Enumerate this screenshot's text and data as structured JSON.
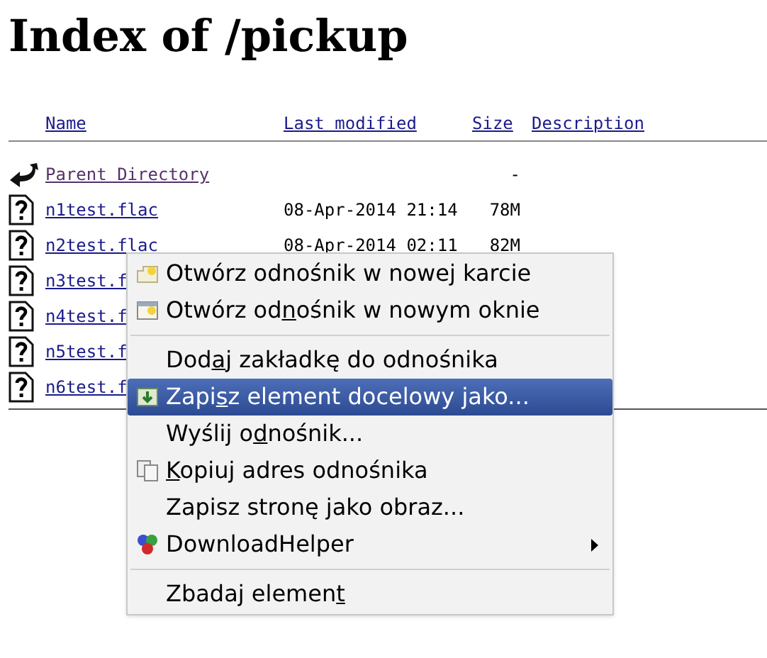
{
  "title": "Index of /pickup",
  "columns": [
    "Name",
    "Last modified",
    "Size",
    "Description"
  ],
  "rows": [
    {
      "kind": "parent",
      "name": "Parent Directory",
      "size": "-"
    },
    {
      "kind": "file",
      "name": "n1test.flac",
      "modified": "08-Apr-2014 21:14",
      "size": "78M"
    },
    {
      "kind": "file",
      "name": "n2test.flac",
      "modified": "08-Apr-2014 02:11",
      "size": "82M"
    },
    {
      "kind": "file",
      "name": "n3test.f"
    },
    {
      "kind": "file",
      "name": "n4test.f"
    },
    {
      "kind": "file",
      "name": "n5test.f"
    },
    {
      "kind": "file",
      "name": "n6test.f"
    }
  ],
  "context_menu": {
    "items": [
      {
        "kind": "item",
        "before": "Otwórz odnośnik w nowej karcie",
        "selected": false,
        "submenu": false
      },
      {
        "kind": "item",
        "before": "Otwórz od",
        "key": "n",
        "after": "ośnik w nowym oknie",
        "selected": false,
        "submenu": false
      },
      {
        "kind": "separator"
      },
      {
        "kind": "item",
        "before": "Dod",
        "key": "a",
        "after": "j zakładkę do odnośnika",
        "selected": false,
        "submenu": false
      },
      {
        "kind": "item",
        "before": "Zapi",
        "key": "s",
        "after": "z element docelowy jako...",
        "selected": true,
        "submenu": false
      },
      {
        "kind": "item",
        "before": "Wyślij o",
        "key": "d",
        "after": "nośnik...",
        "selected": false,
        "submenu": false
      },
      {
        "kind": "item",
        "key": "K",
        "after": "opiuj adres odnośnika",
        "selected": false,
        "submenu": false
      },
      {
        "kind": "item",
        "before": "Zapisz stronę jako obraz...",
        "selected": false,
        "submenu": false
      },
      {
        "kind": "item",
        "before": "DownloadHelper",
        "selected": false,
        "submenu": true
      },
      {
        "kind": "separator"
      },
      {
        "kind": "item",
        "before": "Zbadaj elemen",
        "key": "t",
        "selected": false,
        "submenu": false
      }
    ]
  }
}
